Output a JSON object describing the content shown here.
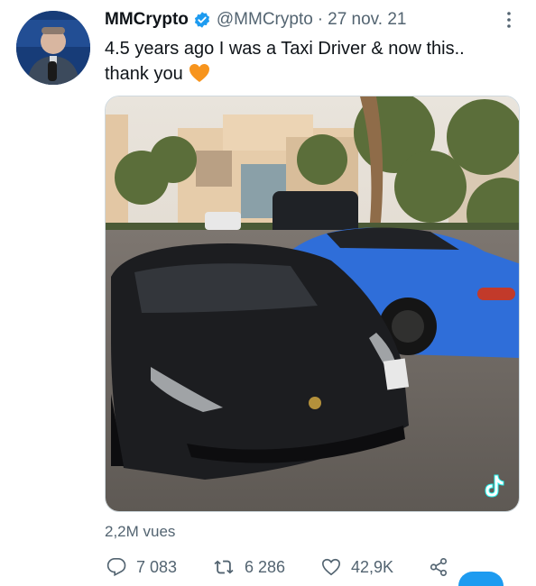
{
  "tweet": {
    "display_name": "MMCrypto",
    "handle": "@MMCrypto",
    "separator": "·",
    "date": "27 nov. 21",
    "text": "4.5 years ago I was a Taxi Driver & now this..\nthank you",
    "emoji": "orange-heart-icon",
    "views": "2,2M vues"
  },
  "actions": {
    "replies": "7 083",
    "retweets": "6 286",
    "likes": "42,9K"
  },
  "colors": {
    "verified": "#1d9bf0",
    "heart": "#f7941d",
    "muted": "#536471"
  }
}
